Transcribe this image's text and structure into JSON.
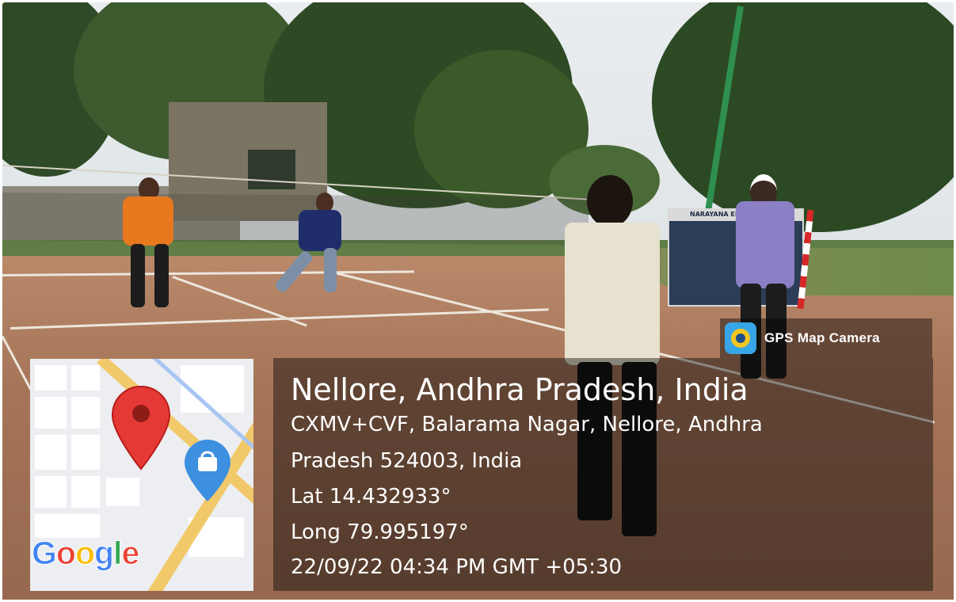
{
  "overlay": {
    "app_name": "GPS Map Camera",
    "place_title": "Nellore, Andhra Pradesh, India",
    "address_line_1": "CXMV+CVF, Balarama Nagar, Nellore, Andhra",
    "address_line_2": "Pradesh 524003, India",
    "latitude": "Lat 14.432933°",
    "longitude": "Long 79.995197°",
    "datetime": "22/09/22 04:34 PM GMT +05:30"
  },
  "map": {
    "logo_letters": [
      "G",
      "o",
      "o",
      "g",
      "l",
      "e"
    ],
    "logo_colors": [
      "#4285F4",
      "#EA4335",
      "#FBBC05",
      "#4285F4",
      "#34A853",
      "#EA4335"
    ],
    "pin_color": "#e53935",
    "shop_pin_color": "#3d8fe0",
    "shop_icon": "shopping-bag-icon"
  },
  "scene": {
    "banner_text": "NARAYANA ENGINEERING C"
  }
}
